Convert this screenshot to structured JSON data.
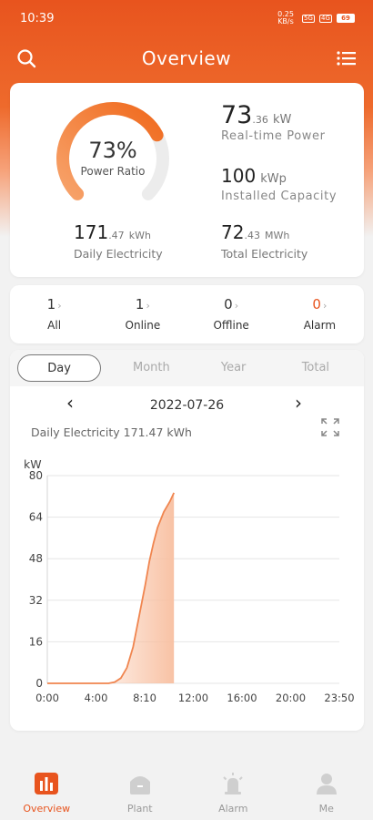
{
  "status_bar": {
    "time": "10:39",
    "net_speed": "0.25 KB/s",
    "signal_1": "5G",
    "signal_2": "4G",
    "battery": "69"
  },
  "header": {
    "title": "Overview",
    "search_icon": "search-icon",
    "menu_icon": "list-icon"
  },
  "summary": {
    "power_ratio_value": "73%",
    "power_ratio_fraction": 0.73,
    "power_ratio_label": "Power Ratio",
    "realtime_power_int": "73",
    "realtime_power_dec": ".36",
    "realtime_power_unit": "kW",
    "realtime_power_label": "Real-time Power",
    "installed_capacity_value": "100",
    "installed_capacity_unit": "kWp",
    "installed_capacity_label": "Installed Capacity",
    "daily_electricity_int": "171",
    "daily_electricity_dec": ".47",
    "daily_electricity_unit": "kWh",
    "daily_electricity_label": "Daily Electricity",
    "total_electricity_int": "72",
    "total_electricity_dec": ".43",
    "total_electricity_unit": "MWh",
    "total_electricity_label": "Total Electricity"
  },
  "plant_status": [
    {
      "count": "1",
      "label": "All"
    },
    {
      "count": "1",
      "label": "Online"
    },
    {
      "count": "0",
      "label": "Offline"
    },
    {
      "count": "0",
      "label": "Alarm"
    }
  ],
  "chart_tabs": [
    "Day",
    "Month",
    "Year",
    "Total"
  ],
  "chart_header": {
    "date": "2022-07-26",
    "daily_text": "Daily Electricity 171.47 kWh"
  },
  "colors": {
    "accent": "#e8541e",
    "line": "#f0854f"
  },
  "chart_data": {
    "type": "area",
    "ylabel": "kW",
    "ylim": [
      0,
      80
    ],
    "yticks": [
      0,
      16,
      32,
      48,
      64,
      80
    ],
    "xticks": [
      "0:00",
      "4:00",
      "8:10",
      "12:00",
      "16:00",
      "20:00",
      "23:50"
    ],
    "xlim_minutes": [
      0,
      1430
    ],
    "series": [
      {
        "x_minutes": [
          0,
          120,
          240,
          300,
          330,
          360,
          390,
          420,
          450,
          480,
          500,
          520,
          540,
          570,
          600,
          620
        ],
        "values": [
          0,
          0,
          0,
          0,
          0.5,
          2,
          6,
          14,
          26,
          38,
          47,
          54,
          60,
          66,
          70,
          73.36
        ]
      }
    ],
    "grid": true
  },
  "tabbar": [
    {
      "label": "Overview",
      "icon": "bar-chart-icon",
      "active": true
    },
    {
      "label": "Plant",
      "icon": "plant-house-icon",
      "active": false
    },
    {
      "label": "Alarm",
      "icon": "alarm-bell-icon",
      "active": false
    },
    {
      "label": "Me",
      "icon": "person-icon",
      "active": false
    }
  ]
}
